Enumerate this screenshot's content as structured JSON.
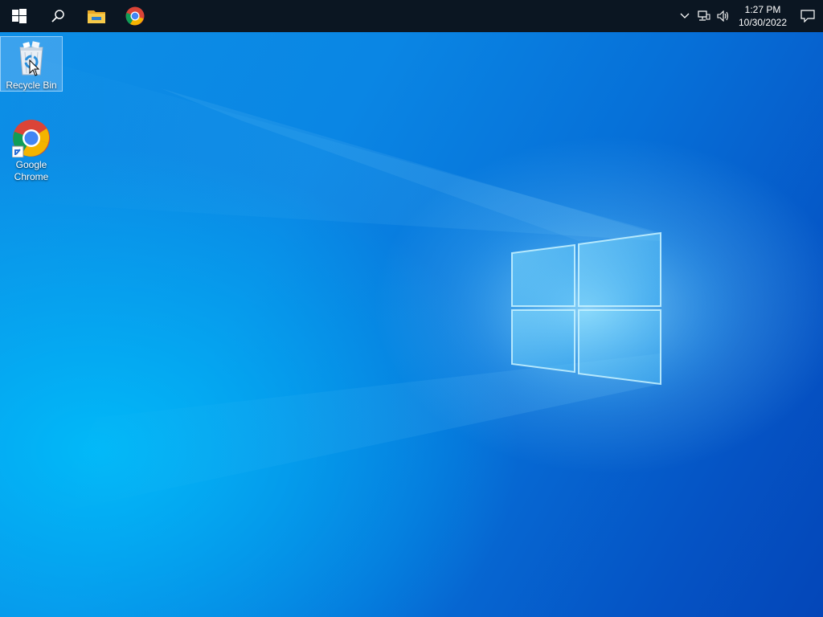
{
  "taskbar": {
    "start_icon": "windows-start-icon",
    "search_icon": "search-icon",
    "pinned": [
      {
        "name": "file-explorer",
        "icon": "folder-icon"
      },
      {
        "name": "google-chrome",
        "icon": "chrome-icon"
      }
    ],
    "tray": {
      "overflow_icon": "chevron-up-icon",
      "network_icon": "network-icon",
      "volume_icon": "volume-icon",
      "time": "1:27 PM",
      "date": "10/30/2022",
      "notification_icon": "action-center-icon"
    }
  },
  "desktop": {
    "icons": [
      {
        "label": "Recycle Bin",
        "icon": "recycle-bin-icon",
        "selected": true
      },
      {
        "label": "Google\nChrome",
        "icon": "chrome-shortcut-icon",
        "selected": false
      }
    ]
  },
  "colors": {
    "taskbar_bg": "#0b1622",
    "wallpaper_main": "#0a86e4",
    "wallpaper_dark": "#0446b8"
  }
}
